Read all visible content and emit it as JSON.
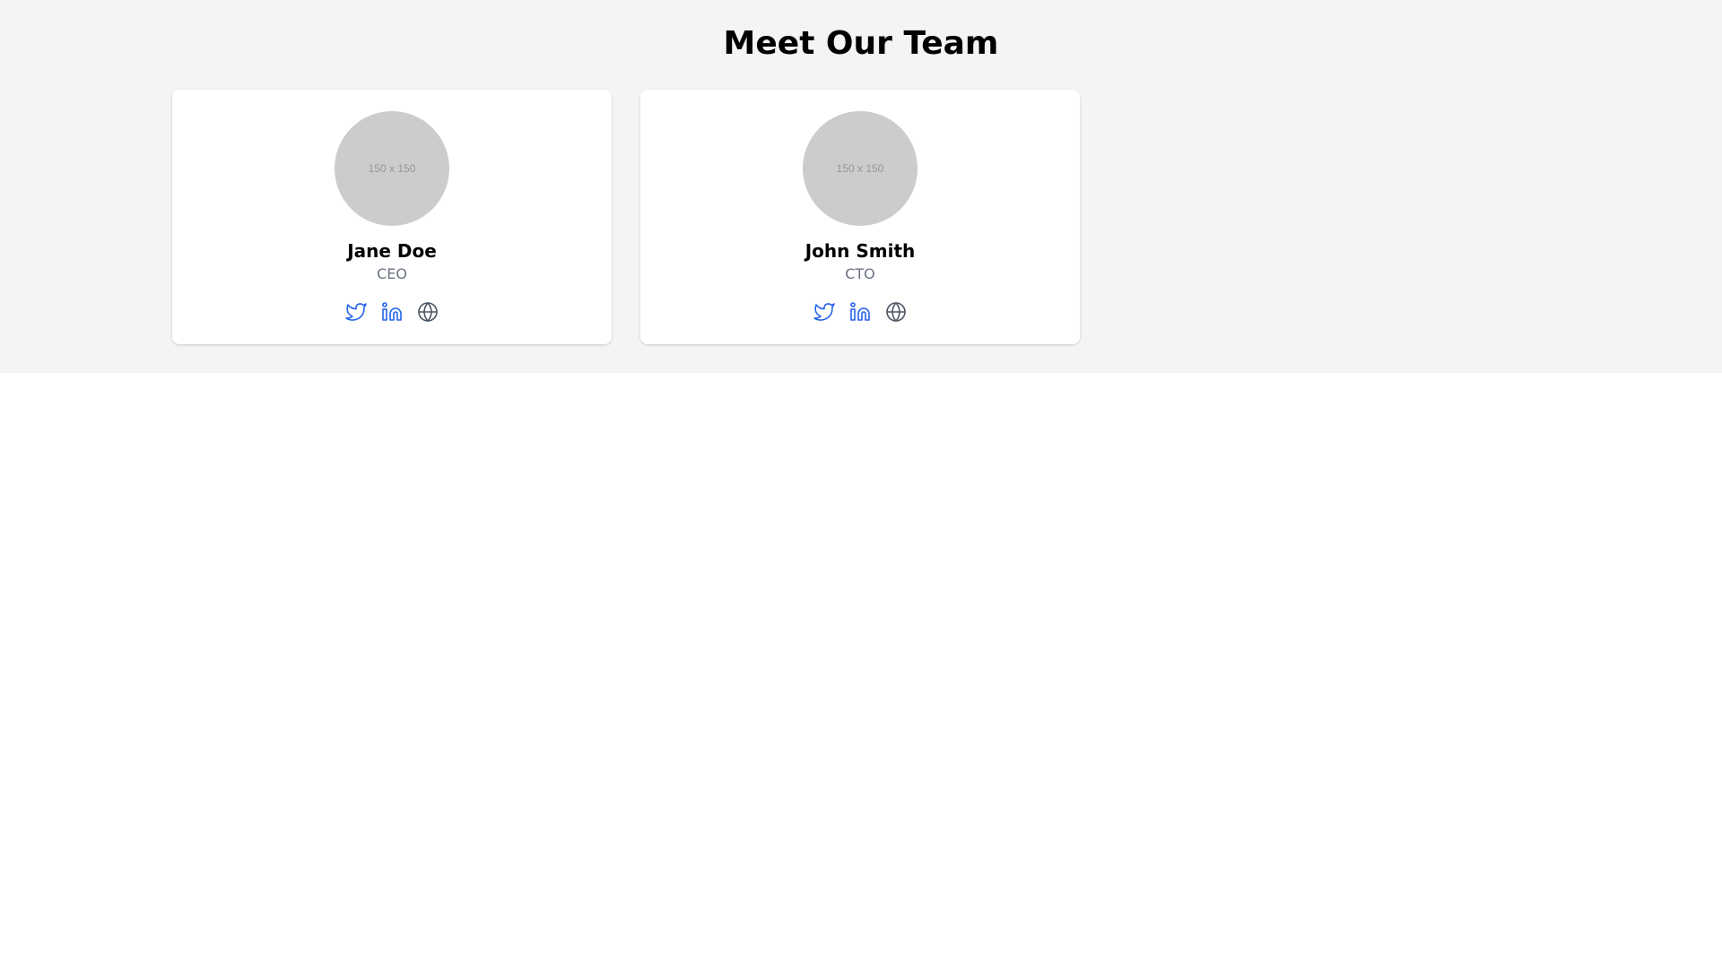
{
  "page": {
    "title": "Meet Our Team"
  },
  "colors": {
    "section_bg": "#f3f4f6",
    "card_bg": "#ffffff",
    "avatar_bg": "#cccccc",
    "link_blue": "#2563eb",
    "globe_gray": "#4b5563",
    "role_gray": "#6b7280"
  },
  "team": [
    {
      "avatar_text": "150 x 150",
      "name": "Jane Doe",
      "role": "CEO",
      "social_icons": [
        "twitter-icon",
        "linkedin-icon",
        "globe-icon"
      ]
    },
    {
      "avatar_text": "150 x 150",
      "name": "John Smith",
      "role": "CTO",
      "social_icons": [
        "twitter-icon",
        "linkedin-icon",
        "globe-icon"
      ]
    }
  ]
}
